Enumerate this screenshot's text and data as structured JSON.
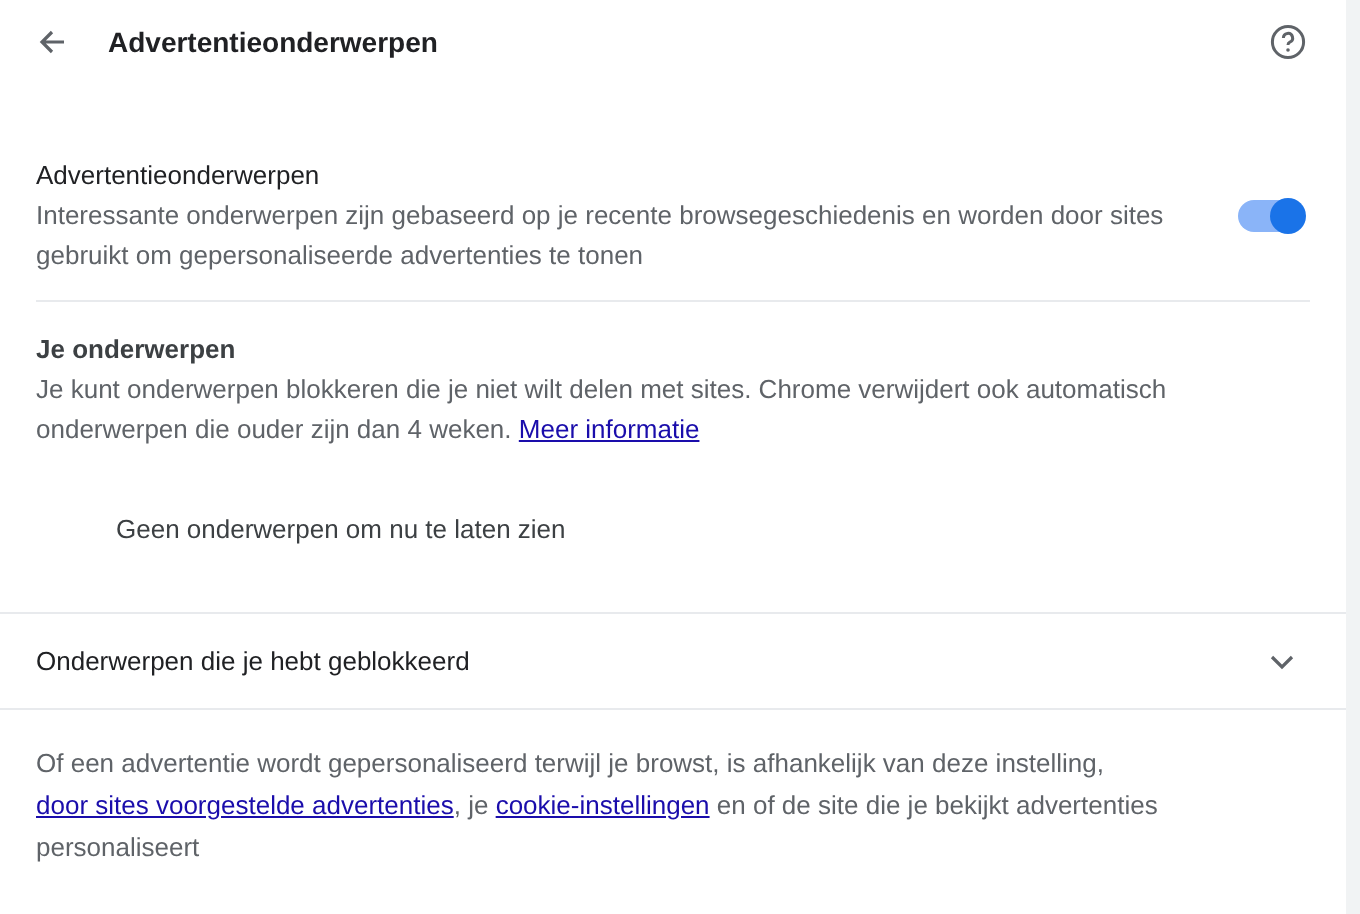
{
  "header": {
    "title": "Advertentieonderwerpen"
  },
  "toggle_row": {
    "title": "Advertentieonderwerpen",
    "description": "Interessante onderwerpen zijn gebaseerd op je recente browsegeschiedenis en worden door sites gebruikt om gepersonaliseerde advertenties te tonen",
    "on": true
  },
  "your_topics": {
    "title": "Je onderwerpen",
    "description": "Je kunt onderwerpen blokkeren die je niet wilt delen met sites. Chrome verwijdert ook automatisch onderwerpen die ouder zijn dan 4 weken.",
    "link": "Meer informatie",
    "empty_message": "Geen onderwerpen om nu te laten zien"
  },
  "blocked": {
    "title": "Onderwerpen die je hebt geblokkeerd",
    "expanded": false
  },
  "footer": [
    {
      "kind": "text",
      "text": "Of een advertentie wordt gepersonaliseerd terwijl je browst, is afhankelijk van deze instelling,"
    },
    {
      "kind": "link",
      "text": "door sites voorgestelde advertenties"
    },
    {
      "kind": "text",
      "text": ", je"
    },
    {
      "kind": "link",
      "text": "cookie-instellingen"
    },
    {
      "kind": "text",
      "text": "en of de site die je bekijkt advertenties personaliseert"
    }
  ]
}
